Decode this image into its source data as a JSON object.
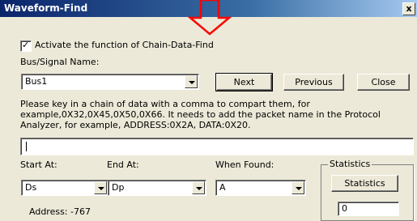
{
  "window": {
    "title": "Waveform-Find",
    "close_label": "x"
  },
  "activate": {
    "label": "Activate the function of Chain-Data-Find",
    "checked": true,
    "check_mark": "✓"
  },
  "bus": {
    "label": "Bus/Signal Name:",
    "value": "Bus1"
  },
  "buttons": {
    "next": "Next",
    "previous": "Previous",
    "close": "Close"
  },
  "description": "Please key in a chain of data with a comma to compart them, for example,0X32,0X45,0X50,0X66.  It needs to add the packet name in the Protocol Analyzer, for example, ADDRESS:0X2A, DATA:0X20.",
  "data_input": {
    "value": ""
  },
  "start_at": {
    "label": "Start At:",
    "value": "Ds"
  },
  "end_at": {
    "label": "End At:",
    "value": "Dp"
  },
  "when_found": {
    "label": "When Found:",
    "value": "A"
  },
  "statistics": {
    "group_label": "Statistics",
    "button_label": "Statistics",
    "count": "0"
  },
  "address": {
    "text": "Address: -767"
  },
  "colors": {
    "title_bar": "#0a246a",
    "arrow": "#ff0000",
    "background": "#ece9d8"
  }
}
